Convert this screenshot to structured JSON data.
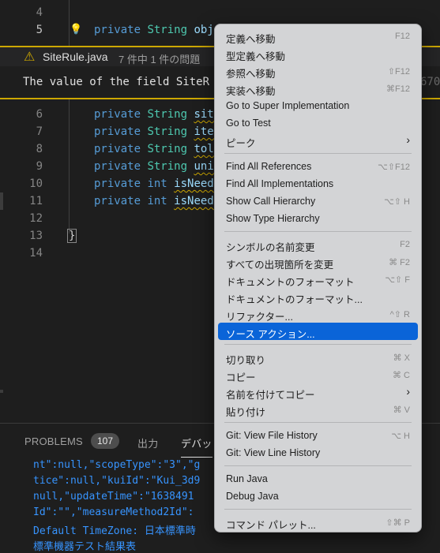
{
  "editor": {
    "top_lines": [
      {
        "num": "4",
        "code": ""
      },
      {
        "num": "5",
        "code_parts": [
          {
            "t": "private ",
            "c": "kw"
          },
          {
            "t": "String ",
            "c": "ty"
          },
          {
            "t": "obj",
            "c": "id"
          }
        ]
      }
    ],
    "body_lines": [
      {
        "num": "6",
        "parts": [
          {
            "t": "private ",
            "c": "kw"
          },
          {
            "t": "String ",
            "c": "ty"
          },
          {
            "t": "sit",
            "c": "id squig"
          }
        ]
      },
      {
        "num": "7",
        "parts": [
          {
            "t": "private ",
            "c": "kw"
          },
          {
            "t": "String ",
            "c": "ty"
          },
          {
            "t": "ite",
            "c": "id squig"
          }
        ]
      },
      {
        "num": "8",
        "parts": [
          {
            "t": "private ",
            "c": "kw"
          },
          {
            "t": "String ",
            "c": "ty"
          },
          {
            "t": "tol",
            "c": "id squig"
          }
        ]
      },
      {
        "num": "9",
        "parts": [
          {
            "t": "private ",
            "c": "kw"
          },
          {
            "t": "String ",
            "c": "ty"
          },
          {
            "t": "uni",
            "c": "id squig"
          }
        ]
      },
      {
        "num": "10",
        "parts": [
          {
            "t": "private ",
            "c": "kw"
          },
          {
            "t": "int ",
            "c": "kw"
          },
          {
            "t": "isNeed",
            "c": "id squig"
          }
        ]
      },
      {
        "num": "11",
        "parts": [
          {
            "t": "private ",
            "c": "kw"
          },
          {
            "t": "int ",
            "c": "kw"
          },
          {
            "t": "isNeed",
            "c": "id squig"
          }
        ]
      },
      {
        "num": "12",
        "parts": []
      },
      {
        "num": "13",
        "parts": [
          {
            "t": "}",
            "c": "brace"
          }
        ]
      },
      {
        "num": "14",
        "parts": []
      }
    ]
  },
  "peek": {
    "file": "SiteRule.java",
    "count": "7 件中 1 件の問題",
    "message": "The value of the field SiteR",
    "trailing_number": "670"
  },
  "panel": {
    "tabs": {
      "problems": "PROBLEMS",
      "problems_count": "107",
      "output": "出力",
      "debug": "デバッ"
    },
    "lines": [
      "nt\":null,\"scopeType\":\"3\",\"g",
      "tice\":null,\"kuiId\":\"Kui_3d9",
      "null,\"updateTime\":\"1638491",
      "Id\":\"\",\"measureMethod2Id\":",
      "Default TimeZone: 日本標準時",
      "標準機器テスト結果表"
    ]
  },
  "menu": {
    "items": [
      {
        "label": "定義へ移動",
        "shortcut": "F12",
        "group": 0
      },
      {
        "label": "型定義へ移動",
        "shortcut": "",
        "group": 0
      },
      {
        "label": "参照へ移動",
        "shortcut": "⇧F12",
        "group": 0
      },
      {
        "label": "実装へ移動",
        "shortcut": "⌘F12",
        "group": 0
      },
      {
        "label": "Go to Super Implementation",
        "shortcut": "",
        "group": 0
      },
      {
        "label": "Go to Test",
        "shortcut": "",
        "group": 0
      },
      {
        "label": "ピーク",
        "shortcut": "",
        "submenu": true,
        "group": 0
      },
      {
        "label": "Find All References",
        "shortcut": "⌥⇧F12",
        "group": 1
      },
      {
        "label": "Find All Implementations",
        "shortcut": "",
        "group": 1
      },
      {
        "label": "Show Call Hierarchy",
        "shortcut": "⌥⇧ H",
        "group": 1
      },
      {
        "label": "Show Type Hierarchy",
        "shortcut": "",
        "group": 1
      },
      {
        "label": "シンボルの名前変更",
        "shortcut": "F2",
        "group": 2
      },
      {
        "label": "すべての出現箇所を変更",
        "shortcut": "⌘ F2",
        "group": 2
      },
      {
        "label": "ドキュメントのフォーマット",
        "shortcut": "⌥⇧ F",
        "group": 2
      },
      {
        "label": "ドキュメントのフォーマット...",
        "shortcut": "",
        "group": 2
      },
      {
        "label": "リファクター...",
        "shortcut": "^⇧ R",
        "group": 2
      },
      {
        "label": "ソース アクション...",
        "shortcut": "",
        "group": 2,
        "selected": true
      },
      {
        "label": "切り取り",
        "shortcut": "⌘ X",
        "group": 3
      },
      {
        "label": "コピー",
        "shortcut": "⌘ C",
        "group": 3
      },
      {
        "label": "名前を付けてコピー",
        "shortcut": "",
        "submenu": true,
        "group": 3
      },
      {
        "label": "貼り付け",
        "shortcut": "⌘ V",
        "group": 3
      },
      {
        "label": "Git: View File History",
        "shortcut": "⌥ H",
        "group": 4
      },
      {
        "label": "Git: View Line History",
        "shortcut": "",
        "group": 4
      },
      {
        "label": "Run Java",
        "shortcut": "",
        "group": 5
      },
      {
        "label": "Debug Java",
        "shortcut": "",
        "group": 5
      },
      {
        "label": "コマンド パレット...",
        "shortcut": "⇧⌘ P",
        "group": 6
      }
    ]
  },
  "colors": {
    "menu_highlight": "#0a64d8",
    "warning": "#cca700",
    "output_text": "#3794ff"
  }
}
